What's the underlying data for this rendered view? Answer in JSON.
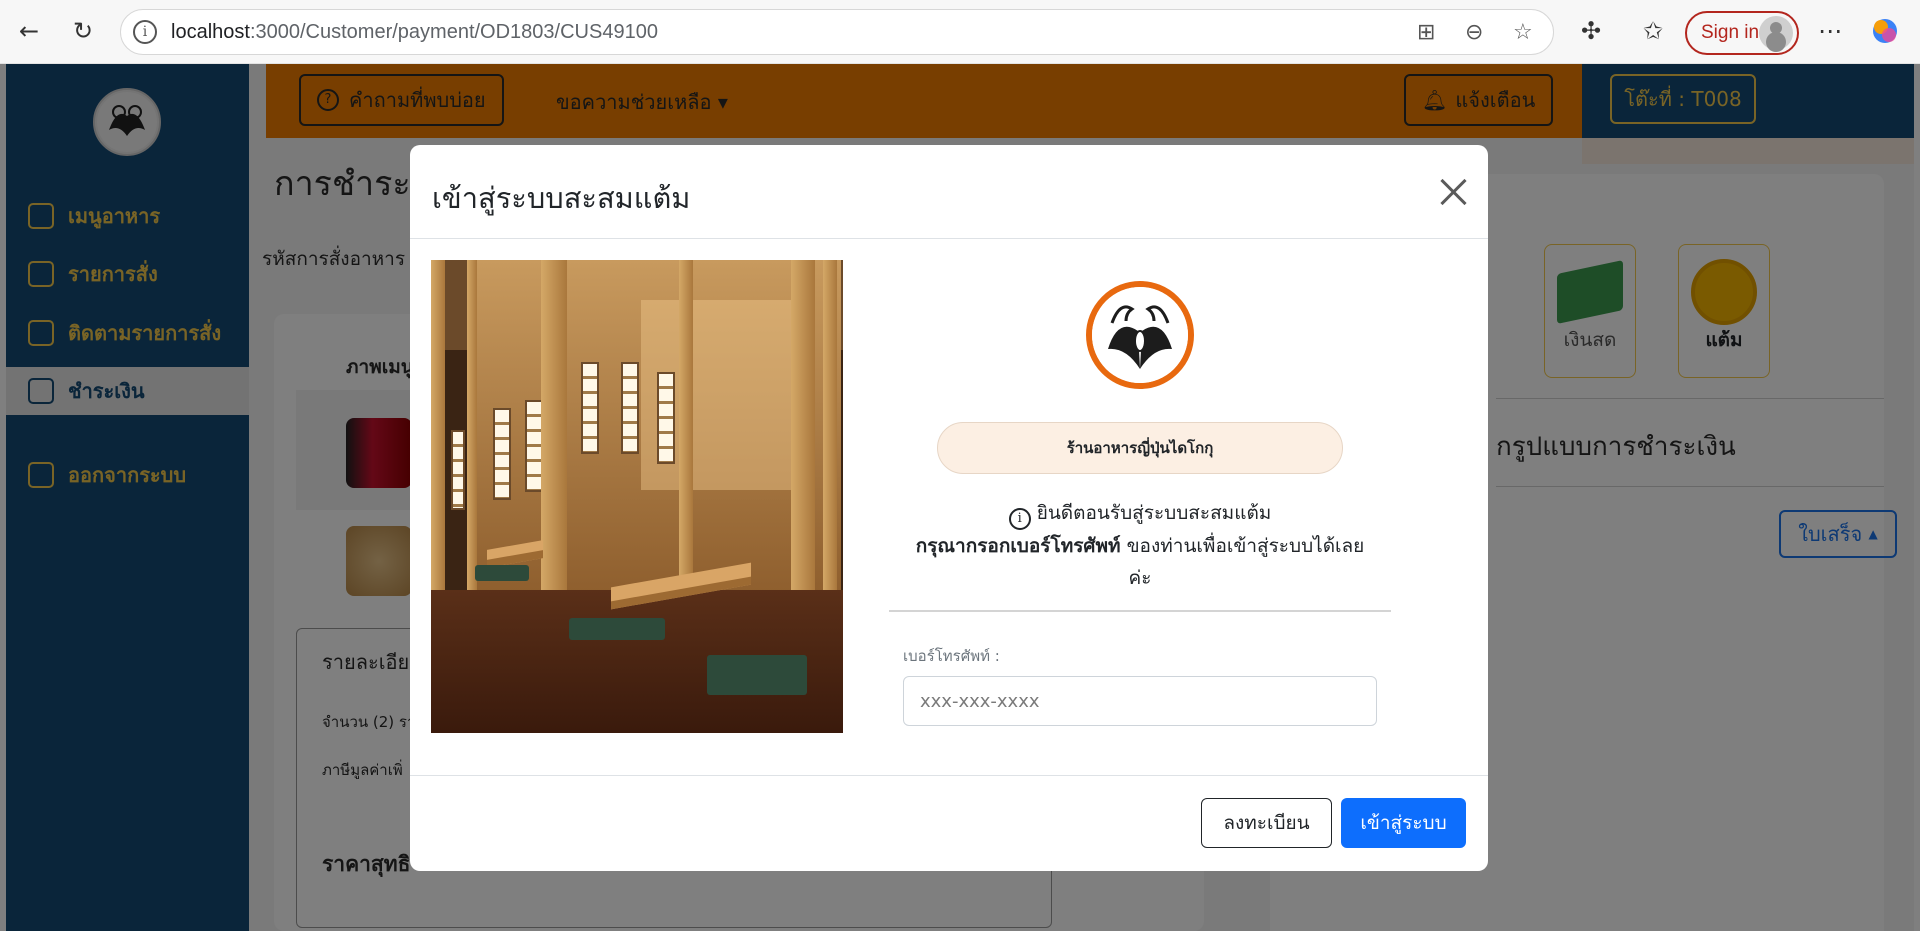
{
  "browser": {
    "url_host": "localhost",
    "url_path": ":3000/Customer/payment/OD1803/CUS49100",
    "signin_label": "Sign in"
  },
  "sidebar": {
    "items": [
      {
        "label": "เมนูอาหาร",
        "icon": "bowl-icon"
      },
      {
        "label": "รายการสั่ง",
        "icon": "list-icon"
      },
      {
        "label": "ติดตามรายการสั่ง",
        "icon": "tracking-icon"
      },
      {
        "label": "ชำระเงิน",
        "icon": "wallet-icon",
        "active": true
      },
      {
        "label": "ออกจากระบบ",
        "icon": "logout-icon"
      }
    ]
  },
  "topnav": {
    "faq_label": "คำถามที่พบบ่อย",
    "help_label": "ขอความช่วยเหลือ",
    "notify_label": "แจ้งเตือน",
    "table_label": "โต๊ะที่ : T008"
  },
  "page": {
    "title": "การชำระเ",
    "order_label": "รหัสการสั่งอาหาร",
    "items_header": "ภาพเมนู",
    "details_title": "รายละเอียด",
    "qty_line": "จำนวน (2) รา",
    "vat_line": "ภาษีมูลค่าเพิ่",
    "net_price": "ราคาสุทธิ",
    "pay_options": [
      "เงินสด",
      "แต้ม"
    ],
    "pay_section": "กรูปแบบการชำระเงิน",
    "receipt_label": "ใบเสร็จ"
  },
  "colors": {
    "sidebar": "#144a75",
    "topnav": "#f07d00",
    "accent": "#f2c94c",
    "primary": "#0d6efd",
    "logo_ring": "#e8690f"
  },
  "modal": {
    "title": "เข้าสู่ระบบสะสมแต้ม",
    "store_name": "ร้านอาหารญี่ปุ่นไดโกกุ",
    "welcome_line1": "ยินดีตอนรับสู่ระบบสะสมแต้ม",
    "welcome_bold": "กรุณากรอกเบอร์โทรศัพท์",
    "welcome_rest": " ของท่านเพื่อเข้าสู่ระบบได้เลยค่ะ",
    "phone_label": "เบอร์โทรศัพท์ :",
    "phone_placeholder": "xxx-xxx-xxxx",
    "phone_value": "",
    "register_label": "ลงทะเบียน",
    "login_label": "เข้าสู่ระบบ"
  }
}
